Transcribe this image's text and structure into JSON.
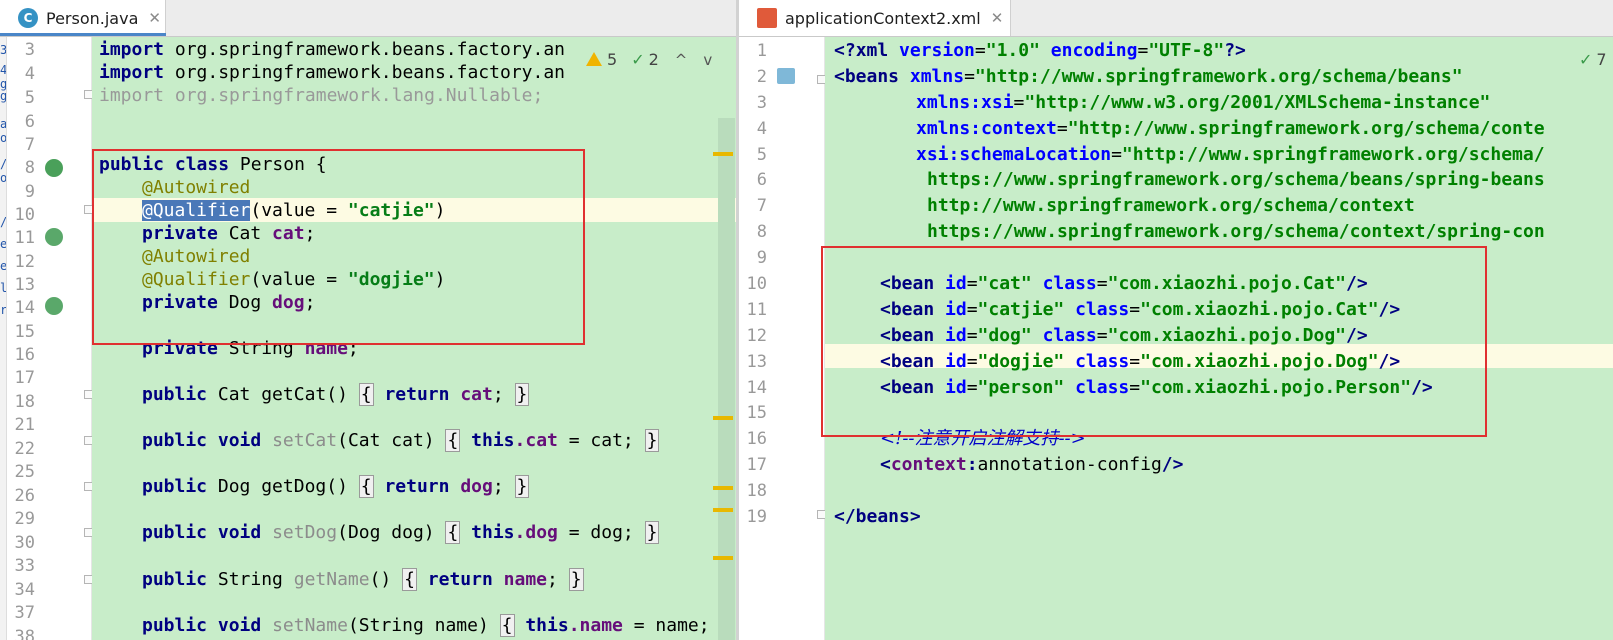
{
  "left": {
    "tab": {
      "label": "Person.java",
      "icon": "java-class-icon",
      "icon_letter": "C",
      "close": "✕"
    },
    "inspection": {
      "warnings": "5",
      "weak_warnings": "2",
      "up": "^",
      "down": "v"
    },
    "lines": [
      {
        "n": "3"
      },
      {
        "n": "4"
      },
      {
        "n": "5"
      },
      {
        "n": "6"
      },
      {
        "n": "7"
      },
      {
        "n": "8"
      },
      {
        "n": "9"
      },
      {
        "n": "10"
      },
      {
        "n": "11"
      },
      {
        "n": "12"
      },
      {
        "n": "13"
      },
      {
        "n": "14"
      },
      {
        "n": "15"
      },
      {
        "n": "16"
      },
      {
        "n": "17"
      },
      {
        "n": "18"
      },
      {
        "n": "21"
      },
      {
        "n": "22"
      },
      {
        "n": "25"
      },
      {
        "n": "26"
      },
      {
        "n": "29"
      },
      {
        "n": "30"
      },
      {
        "n": "33"
      },
      {
        "n": "34"
      },
      {
        "n": "37"
      },
      {
        "n": "38"
      }
    ],
    "code": {
      "l3": {
        "kw": "import",
        "rest": " org.springframework.beans.factory.an"
      },
      "l4": {
        "kw": "import",
        "rest": " org.springframework.beans.factory.an"
      },
      "l5": {
        "kw": "import",
        "rest": " org.springframework.lang.Nullable;"
      },
      "l8": {
        "kw1": "public",
        "kw2": "class",
        "rest": " Person {"
      },
      "l9": {
        "ann": "@Autowired"
      },
      "l10": {
        "ann": "@Qualifier",
        "open": "(value = ",
        "str": "\"catjie\"",
        "close": ")"
      },
      "l11": {
        "kw": "private",
        "type": " Cat ",
        "field": "cat",
        "end": ";"
      },
      "l12": {
        "ann": "@Autowired"
      },
      "l13": {
        "ann": "@Qualifier",
        "open": "(value = ",
        "str": "\"dogjie\"",
        "close": ")"
      },
      "l14": {
        "kw": "private",
        "type": " Dog ",
        "field": "dog",
        "end": ";"
      },
      "l16": {
        "kw": "private",
        "type": " String ",
        "field": "name",
        "end": ";"
      },
      "l18": {
        "kw": "public",
        "mid": " Cat getCat() ",
        "ob": "{",
        "kw2": "return",
        "field": "cat",
        "end": "; ",
        "cb": "}"
      },
      "l22": {
        "kw1": "public",
        "kw2": "void",
        "name": "setCat",
        "params": "(Cat cat) ",
        "ob": "{",
        "kw3": "this",
        "field": ".cat",
        "assign": " = cat; ",
        "cb": "}"
      },
      "l26": {
        "kw": "public",
        "mid": " Dog getDog() ",
        "ob": "{",
        "kw2": "return",
        "field": "dog",
        "end": "; ",
        "cb": "}"
      },
      "l30": {
        "kw1": "public",
        "kw2": "void",
        "name": "setDog",
        "params": "(Dog dog) ",
        "ob": "{",
        "kw3": "this",
        "field": ".dog",
        "assign": " = dog; ",
        "cb": "}"
      },
      "l34": {
        "kw": "public",
        "type": " String ",
        "name": "getName",
        "params": "() ",
        "ob": "{",
        "kw2": "return",
        "field": "name",
        "end": "; ",
        "cb": "}"
      },
      "l38": {
        "kw1": "public",
        "kw2": "void",
        "name": "setName",
        "params": "(String name) ",
        "ob": "{",
        "kw3": "this",
        "field": ".name",
        "assign": " = name; ",
        "cb": "}"
      }
    }
  },
  "right": {
    "tab": {
      "label": "applicationContext2.xml",
      "icon": "xml-file-icon",
      "close": "✕"
    },
    "inspection": {
      "weak_warnings": "7"
    },
    "lines": [
      {
        "n": "1"
      },
      {
        "n": "2"
      },
      {
        "n": "3"
      },
      {
        "n": "4"
      },
      {
        "n": "5"
      },
      {
        "n": "6"
      },
      {
        "n": "7"
      },
      {
        "n": "8"
      },
      {
        "n": "9"
      },
      {
        "n": "10"
      },
      {
        "n": "11"
      },
      {
        "n": "12"
      },
      {
        "n": "13"
      },
      {
        "n": "14"
      },
      {
        "n": "15"
      },
      {
        "n": "16"
      },
      {
        "n": "17"
      },
      {
        "n": "18"
      },
      {
        "n": "19"
      }
    ],
    "code": {
      "l1": {
        "a": "<?",
        "b": "xml",
        "c": " version",
        "d": "=",
        "e": "\"1.0\"",
        "f": " encoding",
        "g": "=",
        "h": "\"UTF-8\"",
        "i": "?>"
      },
      "l2": {
        "tag": "<beans",
        "attr": " xmlns",
        "eq": "=",
        "val": "\"http://www.springframework.org/schema/beans\""
      },
      "l3": {
        "attr": "xmlns:xsi",
        "eq": "=",
        "val": "\"http://www.w3.org/2001/XMLSchema-instance\""
      },
      "l4": {
        "attr": "xmlns:context",
        "eq": "=",
        "val": "\"http://www.springframework.org/schema/conte"
      },
      "l5": {
        "attr": "xsi:schemaLocation",
        "eq": "=",
        "val": "\"http://www.springframework.org/schema/"
      },
      "l6": {
        "val": "https://www.springframework.org/schema/beans/spring-beans"
      },
      "l7": {
        "val": "http://www.springframework.org/schema/context"
      },
      "l8": {
        "val": "https://www.springframework.org/schema/context/spring-con"
      },
      "beans": [
        {
          "open": "<bean",
          "id_attr": " id",
          "eq": "=",
          "id": "\"cat\"",
          "cls_attr": " class",
          "eq2": "=",
          "cls": "\"com.xiaozhi.pojo.Cat\"",
          "close": "/>"
        },
        {
          "open": "<bean",
          "id_attr": " id",
          "eq": "=",
          "id": "\"catjie\"",
          "cls_attr": " class",
          "eq2": "=",
          "cls": "\"com.xiaozhi.pojo.Cat\"",
          "close": "/>"
        },
        {
          "open": "<bean",
          "id_attr": " id",
          "eq": "=",
          "id": "\"dog\"",
          "cls_attr": " class",
          "eq2": "=",
          "cls": "\"com.xiaozhi.pojo.Dog\"",
          "close": "/>"
        },
        {
          "open": "<bean",
          "id_attr": " id",
          "eq": "=",
          "id": "\"dogjie\"",
          "cls_attr": " class",
          "eq2": "=",
          "cls": "\"com.xiaozhi.pojo.Dog\"",
          "close": "/>"
        },
        {
          "open": "<bean",
          "id_attr": " id",
          "eq": "=",
          "id": "\"person\"",
          "cls_attr": " class",
          "eq2": "=",
          "cls": "\"com.xiaozhi.pojo.Person\"",
          "close": "/>"
        }
      ],
      "l16": {
        "comment": "<!--注意开启注解支持-->"
      },
      "l17": {
        "lt": "<",
        "ns": "context",
        "colon": ":",
        "name": "annotation-config",
        "end": "/>"
      },
      "l19": {
        "tag": "</beans",
        "end": ">"
      }
    }
  },
  "left_edge_chars": [
    "3",
    "4",
    "g",
    "g",
    "",
    "a",
    "o",
    "/",
    "o",
    "",
    "/",
    "e",
    "e",
    "l",
    "r"
  ],
  "colors": {
    "code_bg": "#c8edc9",
    "current_line": "#fdfbe3",
    "keyword": "#000080",
    "string": "#067d17",
    "annotation": "#808000",
    "field": "#660e7a",
    "annotation_box": "#e03030",
    "selection": "#4a78b8"
  }
}
